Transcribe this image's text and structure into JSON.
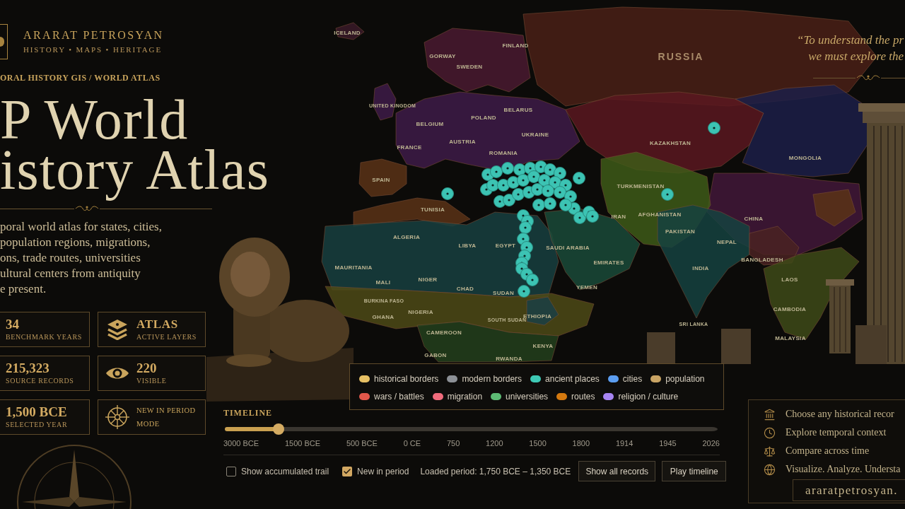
{
  "brand": {
    "name": "ARARAT PETROSYAN",
    "tagline": "HISTORY • MAPS • HERITAGE"
  },
  "hero": {
    "eyebrow": "ORAL HISTORY GIS / WORLD ATLAS",
    "title_lines": [
      "P World",
      "istory Atlas"
    ],
    "description_lines": [
      "poral world atlas for states, cities,",
      "population regions, migrations,",
      "ons, trade routes, universities",
      "ultural centers from antiquity",
      "e present."
    ]
  },
  "stats": [
    {
      "kind": "plain",
      "value": "34",
      "label": "BENCHMARK YEARS"
    },
    {
      "kind": "icon",
      "value": "ATLAS",
      "label": "ACTIVE LAYERS"
    },
    {
      "kind": "plain",
      "value": "215,323",
      "label": "SOURCE RECORDS"
    },
    {
      "kind": "icon",
      "value": "220",
      "label": "VISIBLE"
    },
    {
      "kind": "plain",
      "value": "1,500 BCE",
      "label": "SELECTED YEAR"
    },
    {
      "kind": "icon_text",
      "value": "NEW IN PERIOD",
      "label": "MODE"
    }
  ],
  "map": {
    "labels": [
      "ICELAND",
      "GORWAY",
      "SWEDEN",
      "FINLAND",
      "RUSSIA",
      "UNITED KINGDOM",
      "POLAND",
      "BELARUS",
      "BELGIUM",
      "UKRAINE",
      "FRANCE",
      "AUSTRIA",
      "ROMANIA",
      "KAZAKHSTAN",
      "MONGOLIA",
      "SPAIN",
      "TUNISIA",
      "TURKMENISTAN",
      "IRAN",
      "AFGHANISTAN",
      "CHINA",
      "ALGERIA",
      "LIBYA",
      "EGYPT",
      "SAUDI ARABIA",
      "PAKISTAN",
      "NEPAL",
      "EMIRATES",
      "MAURITANIA",
      "INDIA",
      "BANGLADESH",
      "MALI",
      "NIGER",
      "CHAD",
      "SUDAN",
      "YEMEN",
      "LAOS",
      "CAMBODIA",
      "BURKINA FASO",
      "GHANA",
      "NIGERIA",
      "SOUTH SUDAN",
      "ETHIOPIA",
      "SRI LANKA",
      "KENYA",
      "CAMEROON",
      "MALAYSIA",
      "GABON",
      "RWANDA"
    ]
  },
  "legend": [
    {
      "label": "historical borders",
      "color": "#e6c064"
    },
    {
      "label": "modern borders",
      "color": "#8c9096"
    },
    {
      "label": "ancient places",
      "color": "#3ec9b5"
    },
    {
      "label": "cities",
      "color": "#5b9df0"
    },
    {
      "label": "population",
      "color": "#c9a464"
    },
    {
      "label": "wars / battles",
      "color": "#e0574a"
    },
    {
      "label": "migration",
      "color": "#f06b7c"
    },
    {
      "label": "universities",
      "color": "#5dbb74"
    },
    {
      "label": "routes",
      "color": "#d4790f"
    },
    {
      "label": "religion / culture",
      "color": "#a785f2"
    }
  ],
  "timeline": {
    "title": "TIMELINE",
    "level": 0.109,
    "ticks": [
      "3000 BCE",
      "1500 BCE",
      "500 BCE",
      "0 CE",
      "750",
      "1200",
      "1500",
      "1800",
      "1914",
      "1945",
      "2026"
    ]
  },
  "controls": {
    "options": [
      {
        "label": "Show accumulated trail",
        "checked": false
      },
      {
        "label": "New in period",
        "checked": true
      }
    ],
    "loaded_period": "Loaded period: 1,750 BCE – 1,350 BCE",
    "buttons": [
      "Show all records",
      "Play timeline"
    ]
  },
  "quote": {
    "lines": [
      "“To understand the pr",
      "we must explore the"
    ]
  },
  "features": {
    "items": [
      "Choose any historical recor",
      "Explore temporal context",
      "Compare across time",
      "Visualize. Analyze. Understa"
    ],
    "url": "araratpetrosyan."
  }
}
